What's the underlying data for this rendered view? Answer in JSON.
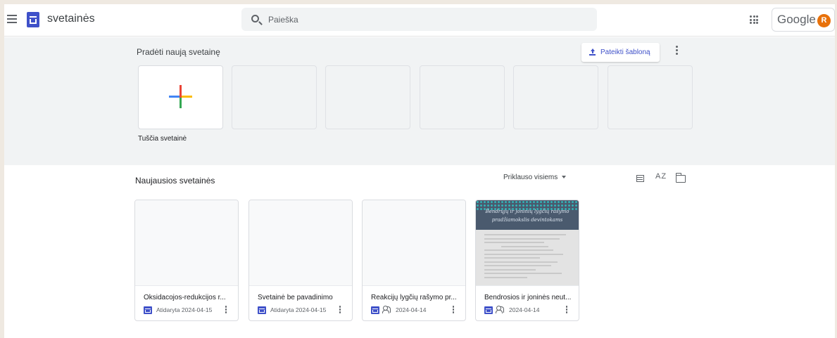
{
  "header": {
    "app_title": "svetainės",
    "search_placeholder": "Paieška",
    "google_label": "Google",
    "avatar_initial": "R"
  },
  "start": {
    "title": "Pradėti naują svetainę",
    "upload_label": "Pateikti šabloną",
    "blank_label": "Tuščia svetainė"
  },
  "recent": {
    "title": "Naujausios svetainės",
    "owner_filter": "Priklauso visiems",
    "sort_label": "AZ",
    "cards": [
      {
        "title": "Oksidacojos-redukcijos r...",
        "meta": "Atidaryta 2024-04-15",
        "shared": false
      },
      {
        "title": "Svetainė be pavadinimo",
        "meta": "Atidaryta 2024-04-15",
        "shared": false
      },
      {
        "title": "Reakcijų lygčių rašymo pr...",
        "meta": "2024-04-14",
        "shared": true
      },
      {
        "title": "Bendrosios ir joninės neut...",
        "meta": "2024-04-14",
        "shared": true
      }
    ],
    "thumb_banner_line1": "Bendrųjų ir joninių lygčių rašymo",
    "thumb_banner_line2": "pradžiamokslis devintokams"
  },
  "colors": {
    "brand": "#3f51c9",
    "avatar": "#e8710a",
    "plus_red": "#ea4335",
    "plus_blue": "#4285f4",
    "plus_green": "#34a853",
    "plus_yellow": "#fbbc04"
  }
}
